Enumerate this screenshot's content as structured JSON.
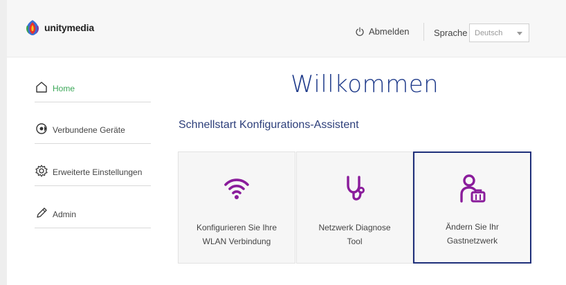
{
  "header": {
    "logo_text": "unitymedia",
    "logout_label": "Abmelden",
    "language_label": "Sprache",
    "language_selected": "Deutsch"
  },
  "sidebar": {
    "items": [
      {
        "label": "Home",
        "icon": "home-icon",
        "active": true
      },
      {
        "label": "Verbundene Geräte",
        "icon": "devices-icon",
        "active": false
      },
      {
        "label": "Erweiterte Einstellungen",
        "icon": "gear-icon",
        "active": false
      },
      {
        "label": "Admin",
        "icon": "pencil-icon",
        "active": false
      }
    ]
  },
  "main": {
    "title": "Willkommen",
    "section_title": "Schnellstart Konfigurations-Assistent",
    "tiles": [
      {
        "line1": "Konfigurieren Sie Ihre",
        "line2": "WLAN Verbindung",
        "icon": "wifi-icon"
      },
      {
        "line1": "Netzwerk Diagnose",
        "line2": "Tool",
        "icon": "stethoscope-icon"
      },
      {
        "line1": "Ändern Sie Ihr",
        "line2": "Gastnetzwerk",
        "icon": "guest-user-icon"
      }
    ]
  },
  "colors": {
    "accent_green": "#3aa757",
    "title_blue": "#1e3a8a",
    "icon_purple": "#8a1c9b",
    "selected_border": "#1e2f7a"
  }
}
